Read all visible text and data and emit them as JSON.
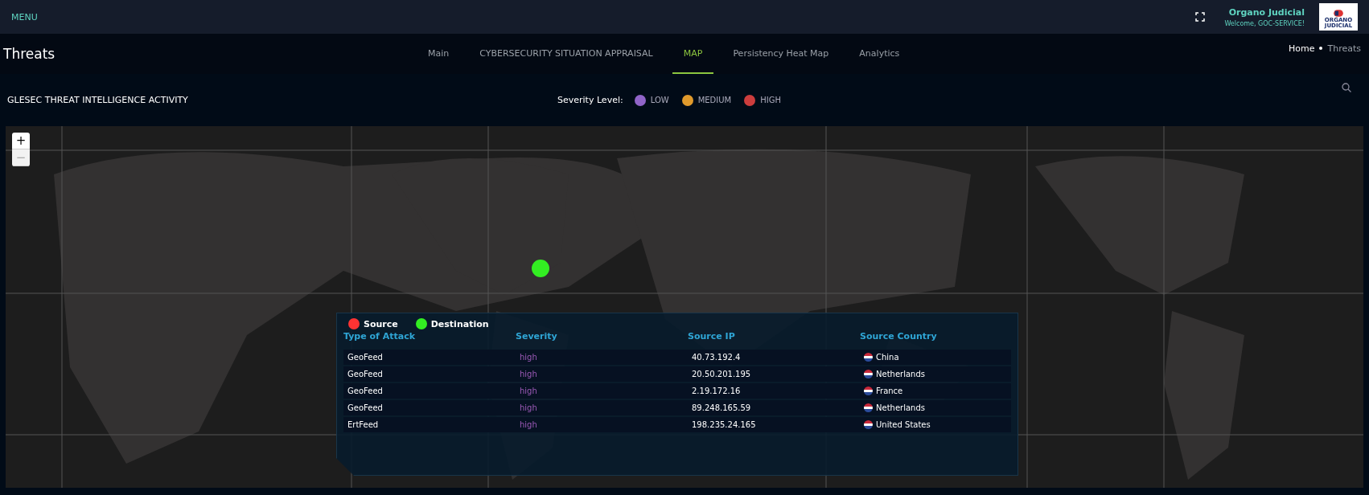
{
  "topbar": {
    "menu": "MENU",
    "org_name": "Organo Judicial",
    "welcome": "Welcome, GOC-SERVICE!",
    "logo_text": "ORGANO JUDICIAL"
  },
  "page_title": "Threats",
  "tabs": [
    {
      "label": "Main",
      "selected": false
    },
    {
      "label": "CYBERSECURITY SITUATION APPRAISAL",
      "selected": false
    },
    {
      "label": "MAP",
      "selected": true
    },
    {
      "label": "Persistency Heat Map",
      "selected": false
    },
    {
      "label": "Analytics",
      "selected": false
    }
  ],
  "breadcrumb": [
    {
      "label": "Home",
      "selected": false
    },
    {
      "label": "Threats",
      "selected": true
    }
  ],
  "panel_title": "GLESEC THREAT INTELLIGENCE ACTIVITY",
  "severity_legend": {
    "label": "Severity Level:",
    "items": [
      {
        "label": "LOW",
        "color": "#9064c8"
      },
      {
        "label": "MEDIUM",
        "color": "#e09a2c"
      },
      {
        "label": "HIGH",
        "color": "#cc3d3d"
      }
    ]
  },
  "map": {
    "zoom_in": "+",
    "zoom_out": "−",
    "zoom_out_disabled": true,
    "markers": [
      {
        "kind": "destination",
        "color": "#33ee22"
      }
    ],
    "legend": [
      {
        "label": "Source",
        "color": "#ff3333"
      },
      {
        "label": "Destination",
        "color": "#33ee22"
      }
    ],
    "table": {
      "columns": [
        "Type of Attack",
        "Severity",
        "Source IP",
        "Source Country"
      ],
      "rows": [
        {
          "attack": "GeoFeed",
          "severity": "high",
          "ip": "40.73.192.4",
          "country": "China"
        },
        {
          "attack": "GeoFeed",
          "severity": "high",
          "ip": "20.50.201.195",
          "country": "Netherlands"
        },
        {
          "attack": "GeoFeed",
          "severity": "high",
          "ip": "2.19.172.16",
          "country": "France"
        },
        {
          "attack": "GeoFeed",
          "severity": "high",
          "ip": "89.248.165.59",
          "country": "Netherlands"
        },
        {
          "attack": "ErtFeed",
          "severity": "high",
          "ip": "198.235.24.165",
          "country": "United States"
        }
      ]
    }
  }
}
